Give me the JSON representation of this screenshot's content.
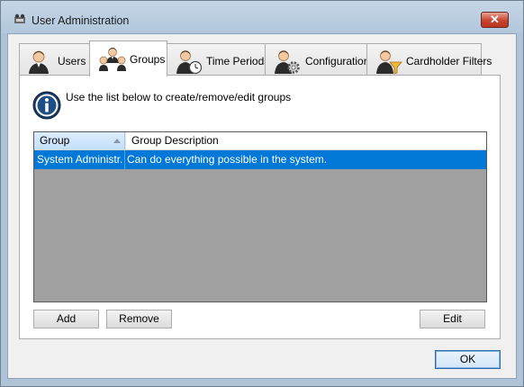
{
  "window": {
    "title": "User Administration",
    "close_label": "✕",
    "accent_color": "#0078d7",
    "close_color": "#c8442f"
  },
  "tabs": [
    {
      "label": "Users",
      "icon": "user-icon",
      "selected": false
    },
    {
      "label": "Groups",
      "icon": "group-icon",
      "selected": true
    },
    {
      "label": "Time Periods",
      "icon": "user-clock-icon",
      "selected": false
    },
    {
      "label": "Configuration",
      "icon": "user-gear-icon",
      "selected": false
    },
    {
      "label": "Cardholder Filters",
      "icon": "user-filter-icon",
      "selected": false
    }
  ],
  "groups_panel": {
    "info_text": "Use the list below to create/remove/edit groups",
    "list": {
      "columns": [
        "Group",
        "Group Description"
      ],
      "sorted_column": "Group",
      "sort_direction": "ascending",
      "rows": [
        {
          "group": "System Administr...",
          "description": "Can do everything possible in the system.",
          "selected": true
        }
      ]
    },
    "buttons": {
      "add": "Add",
      "remove": "Remove",
      "edit": "Edit"
    }
  },
  "footer": {
    "ok": "OK"
  }
}
